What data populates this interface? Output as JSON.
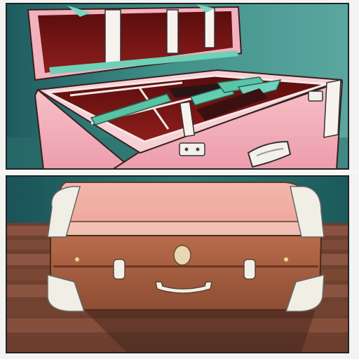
{
  "image": {
    "panels": [
      {
        "subject": "open-suitcase-with-green-handled-tools"
      },
      {
        "subject": "closed-brown-and-pink-suitcase-on-wooden-deck"
      }
    ]
  },
  "colors": {
    "teal_background": "#3d8c87",
    "suitcase_pink": "#f0a7b4",
    "interior_red": "#7a1414",
    "tool_green": "#58c2a4",
    "leather_brown": "#a85e3f",
    "wood_brown": "#7c4a35"
  }
}
